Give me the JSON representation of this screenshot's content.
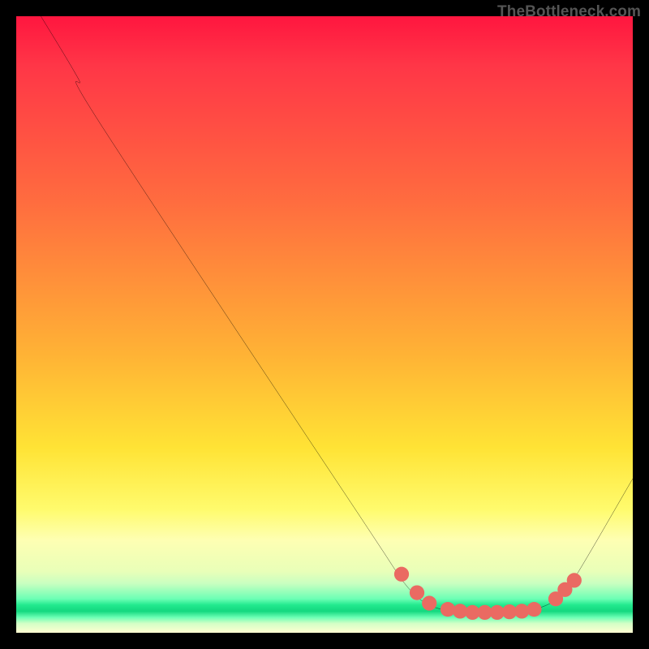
{
  "attribution": "TheBottleneck.com",
  "chart_data": {
    "type": "line",
    "title": "",
    "xlabel": "",
    "ylabel": "",
    "xlim": [
      0,
      100
    ],
    "ylim": [
      0,
      100
    ],
    "curve": {
      "name": "bottleneck-curve",
      "points": [
        {
          "x": 4.0,
          "y": 100.0
        },
        {
          "x": 10.0,
          "y": 90.0
        },
        {
          "x": 14.0,
          "y": 82.0
        },
        {
          "x": 57.0,
          "y": 17.0
        },
        {
          "x": 63.0,
          "y": 8.0
        },
        {
          "x": 67.0,
          "y": 4.5
        },
        {
          "x": 72.0,
          "y": 3.4
        },
        {
          "x": 78.0,
          "y": 3.3
        },
        {
          "x": 83.0,
          "y": 3.6
        },
        {
          "x": 87.0,
          "y": 5.0
        },
        {
          "x": 90.0,
          "y": 8.0
        },
        {
          "x": 100.0,
          "y": 25.0
        }
      ]
    },
    "markers": {
      "color": "#ea6a62",
      "radius_pct": 1.2,
      "points": [
        {
          "x": 62.5,
          "y": 9.5
        },
        {
          "x": 65.0,
          "y": 6.5
        },
        {
          "x": 67.0,
          "y": 4.8
        },
        {
          "x": 70.0,
          "y": 3.8
        },
        {
          "x": 72.0,
          "y": 3.5
        },
        {
          "x": 74.0,
          "y": 3.3
        },
        {
          "x": 76.0,
          "y": 3.3
        },
        {
          "x": 78.0,
          "y": 3.3
        },
        {
          "x": 80.0,
          "y": 3.4
        },
        {
          "x": 82.0,
          "y": 3.5
        },
        {
          "x": 84.0,
          "y": 3.8
        },
        {
          "x": 87.5,
          "y": 5.5
        },
        {
          "x": 89.0,
          "y": 7.0
        },
        {
          "x": 90.5,
          "y": 8.5
        }
      ]
    }
  }
}
